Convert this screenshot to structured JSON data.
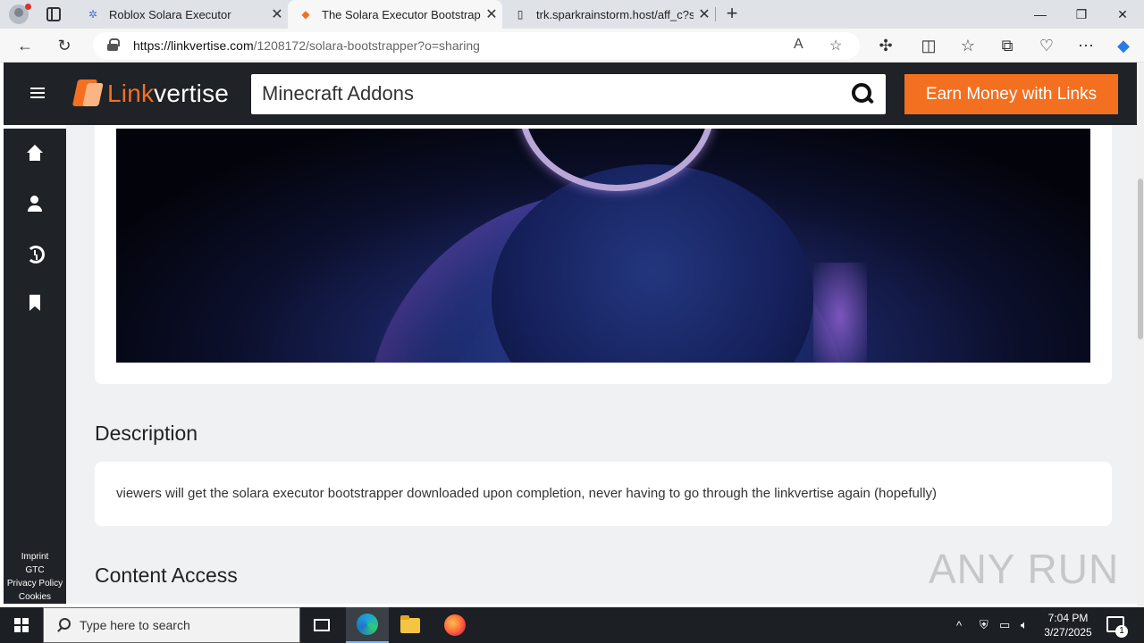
{
  "browser": {
    "tabs": [
      {
        "title": "Roblox Solara Executor",
        "active": false
      },
      {
        "title": "The Solara Executor Bootstrapper",
        "active": true
      },
      {
        "title": "trk.sparkrainstorm.host/aff_c?sou",
        "active": false
      }
    ],
    "url_host": "https://linkvertise.com",
    "url_path": "/1208172/solara-bootstrapper?o=sharing"
  },
  "site": {
    "logo_prefix": "Link",
    "logo_suffix": "vertise",
    "search_value": "Minecraft Addons",
    "cta_label": "Earn Money with Links",
    "accent_color": "#f37021"
  },
  "rail": {
    "links": [
      "Imprint",
      "GTC",
      "Privacy Policy",
      "Cookies"
    ]
  },
  "content": {
    "description_heading": "Description",
    "description_text": "viewers will get the solara executor bootstrapper downloaded upon completion, never having to go through the linkvertise again (hopefully)",
    "access_heading": "Content Access"
  },
  "watermark": "ANY RUN",
  "taskbar": {
    "search_placeholder": "Type here to search",
    "time": "7:04 PM",
    "date": "3/27/2025",
    "notification_count": "1"
  }
}
